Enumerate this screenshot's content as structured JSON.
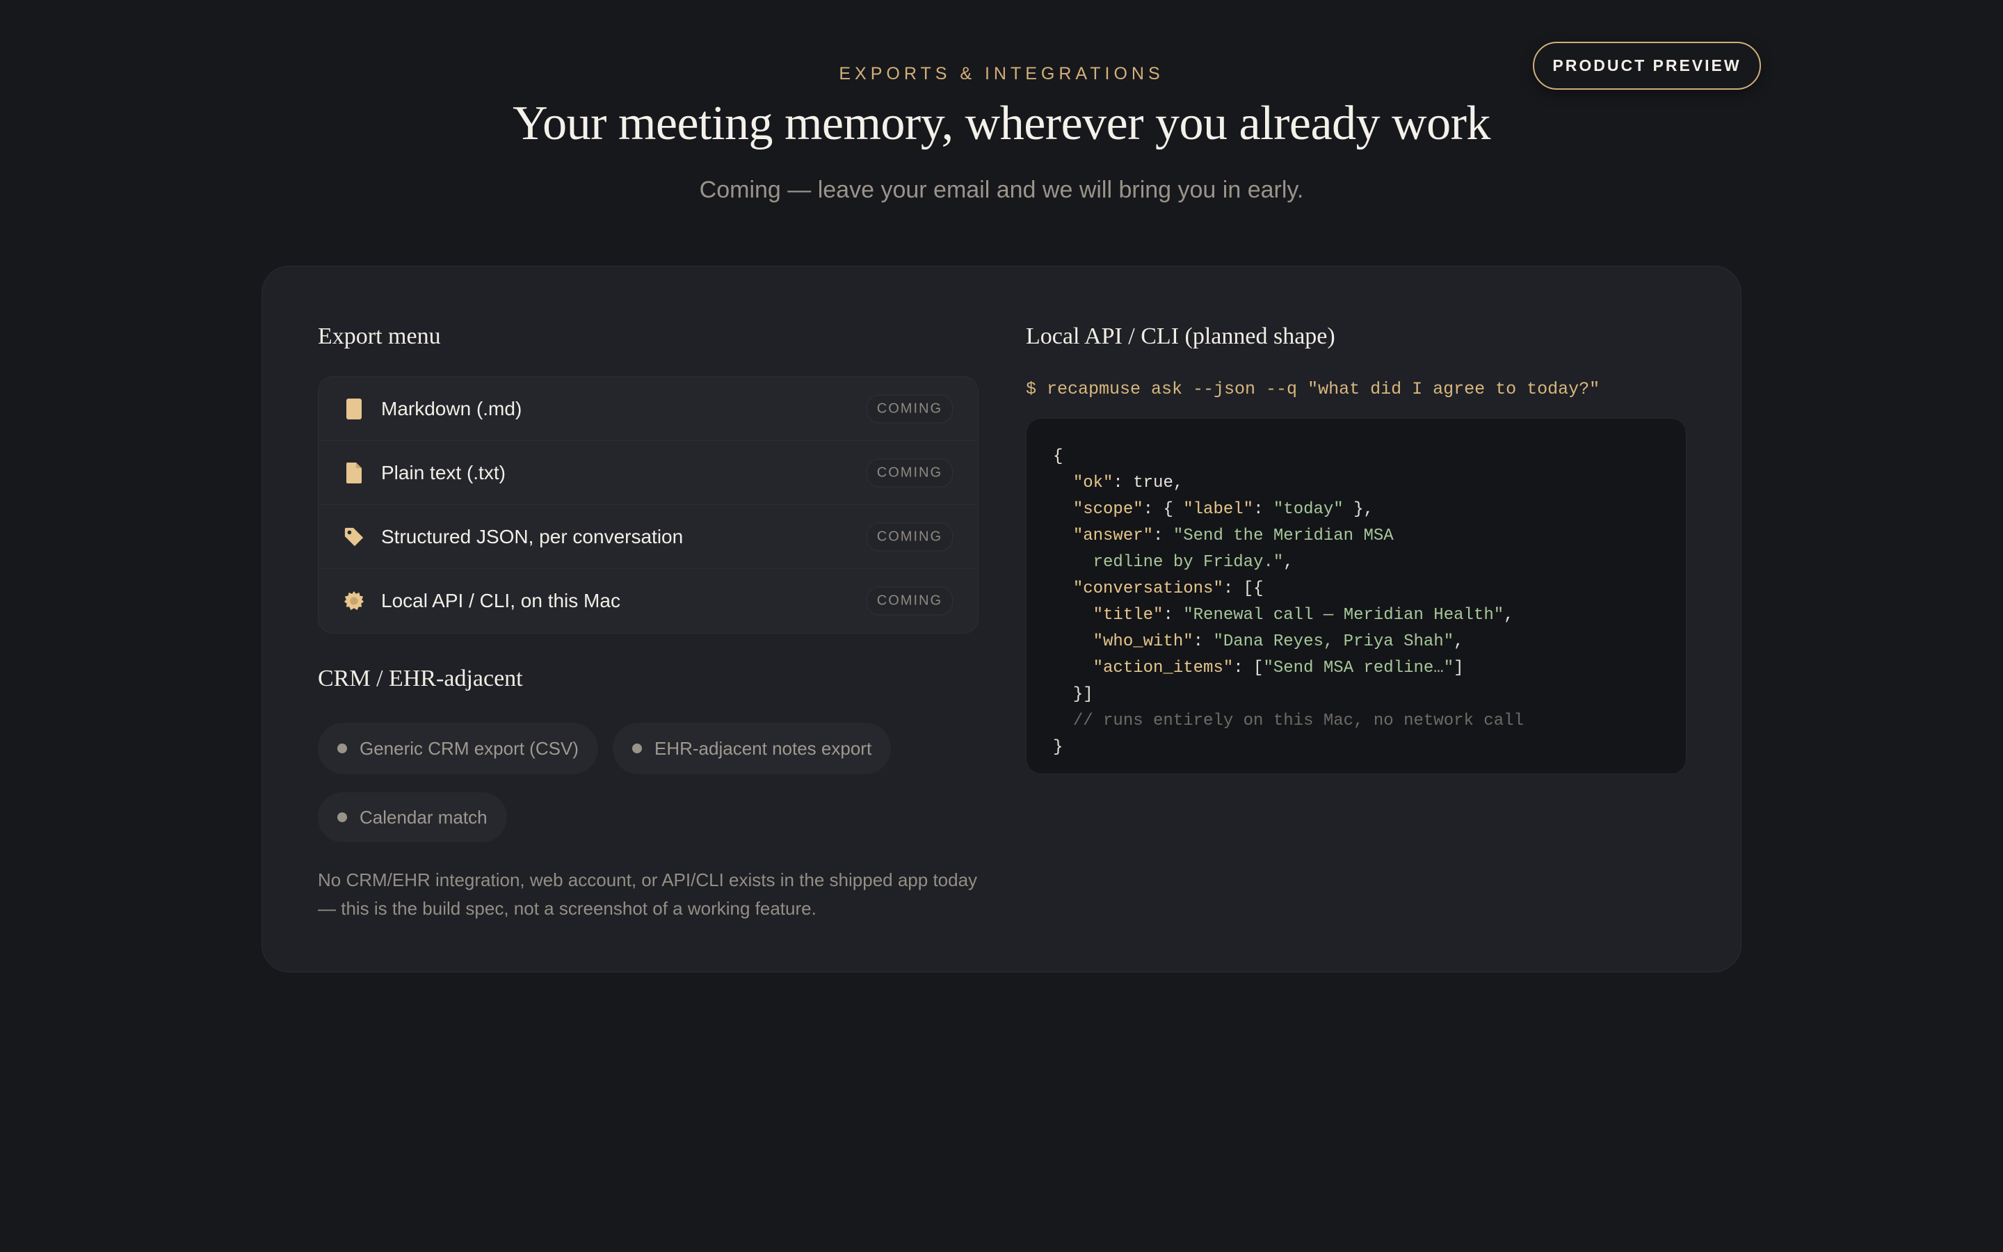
{
  "header": {
    "eyebrow": "EXPORTS & INTEGRATIONS",
    "headline": "Your meeting memory, wherever you already work",
    "subhead": "Coming — leave your email and we will bring you in early.",
    "preview_button": "PRODUCT PREVIEW"
  },
  "export_menu": {
    "title": "Export menu",
    "items": [
      {
        "label": "Markdown (.md)",
        "badge": "COMING",
        "icon": "markdown-file-icon"
      },
      {
        "label": "Plain text (.txt)",
        "badge": "COMING",
        "icon": "text-file-icon"
      },
      {
        "label": "Structured JSON, per conversation",
        "badge": "COMING",
        "icon": "tag-icon"
      },
      {
        "label": "Local API / CLI, on this Mac",
        "badge": "COMING",
        "icon": "gear-badge-icon"
      }
    ]
  },
  "crm": {
    "title": "CRM / EHR-adjacent",
    "chips": [
      "Generic CRM export (CSV)",
      "EHR-adjacent notes export",
      "Calendar match"
    ],
    "footnote": "No CRM/EHR integration, web account, or API/CLI exists in the shipped app today — this is the build spec, not a screenshot of a working feature."
  },
  "api": {
    "title": "Local API / CLI (planned shape)",
    "command": "$ recapmuse ask --json --q \"what did I agree to today?\"",
    "json": {
      "open": "{",
      "ok_key": "\"ok\"",
      "ok_val": "true",
      "scope_key": "\"scope\"",
      "scope_label_key": "\"label\"",
      "scope_label_val": "\"today\"",
      "answer_key": "\"answer\"",
      "answer_val_1": "\"Send the Meridian MSA",
      "answer_val_2": "redline by Friday.\"",
      "conversations_key": "\"conversations\"",
      "title_key": "\"title\"",
      "title_val": "\"Renewal call — Meridian Health\"",
      "who_key": "\"who_with\"",
      "who_val": "\"Dana Reyes, Priya Shah\"",
      "action_key": "\"action_items\"",
      "action_val": "\"Send MSA redline…\"",
      "close_conv": "}]",
      "comment": "// runs entirely on this Mac, no network call",
      "close": "}"
    }
  },
  "colors": {
    "background": "#17181c",
    "card": "#1f2126",
    "accent_gold": "#d4b07a",
    "code_key": "#e6c68c",
    "code_string": "#a7c79a"
  }
}
